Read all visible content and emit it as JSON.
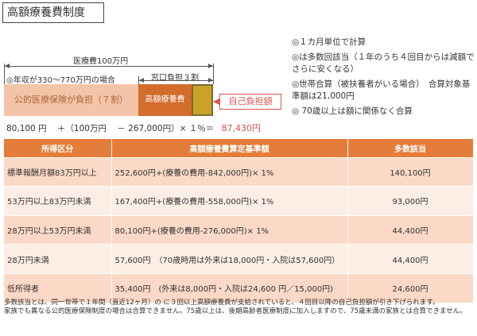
{
  "title": "高額療養費制度",
  "diagram": {
    "total_label": "医療費100万円",
    "income_label": "◎年収が330～770万円の場合",
    "window_label": "窓口負担３割",
    "public_insurance_label": "公的医療保険が負担（７割）",
    "high_cost_label": "高額療養費",
    "self_pay_label": "自己負担額",
    "formula": {
      "base": "80,100 円",
      "plus": "＋（100万円",
      "minus": "－ 267,000円）× １％＝",
      "result": "87,430円"
    }
  },
  "notes": [
    "◎１カ月単位で計算",
    "◎は多数回該当（１年のうち４回目からは減額でさらに安くなる）",
    "◎世帯合算（被扶養者がいる場合）　合算対象基準額は21,000円",
    "◎ 70歳以上は額に関係なく合算"
  ],
  "table": {
    "headers": [
      "所得区分",
      "高額療養費算定基準額",
      "多数該当"
    ],
    "rows": [
      {
        "category": "標準報酬月額83万円以上",
        "formula": "252,600円+(療養の費用-842,000円)× 1%",
        "multiple": "140,100円"
      },
      {
        "category": "53万円以上83万円未満",
        "formula": "167,400円+(療養の費用-558,000円)× 1%",
        "multiple": "93,000円"
      },
      {
        "category": "28万円以上53万円未満",
        "formula": "80,100円+(療養の費用-276,000円)× 1%",
        "multiple": "44,400円"
      },
      {
        "category": "28万円未満",
        "formula": "57,600円　（70歳時用は外来は18,000円・入院は57,600円）",
        "multiple": "44,400円"
      },
      {
        "category": "低所得者",
        "formula": "35,400円　(外来は8,000円・入院は24,600 円／15,000円)",
        "multiple": "24,600円"
      }
    ]
  },
  "footer": [
    "多数該当とは、同一世帯で１年間（直近12ヶ月）の に３回以上高額療養費が支給されていると、４回目以降の自己負担額が引き下げられます。",
    "家族でも異なる公的医療保険制度の場合は合算できません。75歳以上は、後期高齢者医療制度に加入しますので、75歳未満の家族とは合算できません。"
  ],
  "colors": {
    "header_orange": "#e47d39",
    "row_odd": "#fbd9c6",
    "row_even": "#fdeee5",
    "high_cost_bar": "#d46c2c",
    "self_pay_bar": "#c9a227",
    "result_red": "#d9534f"
  }
}
